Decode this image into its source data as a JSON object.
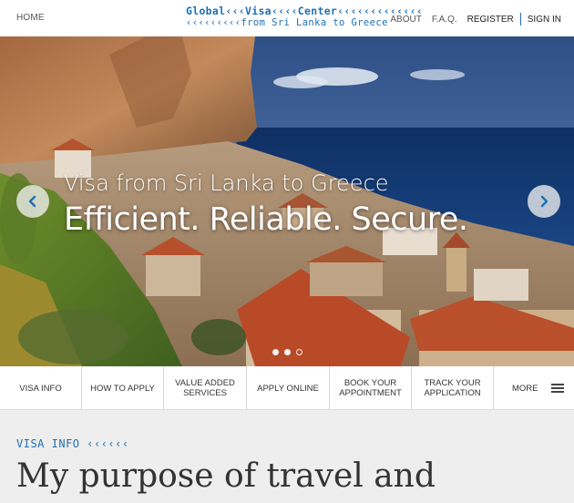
{
  "header": {
    "home_label": "HOME",
    "logo_line1": "Global‹‹‹Visa‹‹‹‹Center‹‹‹‹‹‹‹‹‹‹‹‹‹",
    "logo_line2": "‹‹‹‹‹‹‹‹‹from Sri Lanka to Greece",
    "about_label": "ABOUT",
    "faq_label": "F.A.Q.",
    "register_label": "REGISTER",
    "signin_label": "SIGN IN"
  },
  "hero": {
    "subtitle": "Visa from Sri Lanka to Greece",
    "headline": "Efficient. Reliable. Secure.",
    "prev_icon": "chevron-left-icon",
    "next_icon": "chevron-right-icon",
    "slide_count": 3,
    "active_slide": 3
  },
  "menu": {
    "items": [
      {
        "label": "VISA INFO"
      },
      {
        "label": "HOW TO APPLY"
      },
      {
        "label": "VALUE ADDED SERVICES"
      },
      {
        "label": "APPLY ONLINE"
      },
      {
        "label": "BOOK YOUR APPOINTMENT"
      },
      {
        "label": "TRACK YOUR APPLICATION"
      }
    ],
    "more_label": "MORE",
    "more_icon": "hamburger-menu-icon"
  },
  "content": {
    "section_label": "VISA INFO ‹‹‹‹‹‹",
    "title": "My purpose of travel and"
  },
  "colors": {
    "accent": "#1f6fb2",
    "content_background": "#eeeeee"
  }
}
